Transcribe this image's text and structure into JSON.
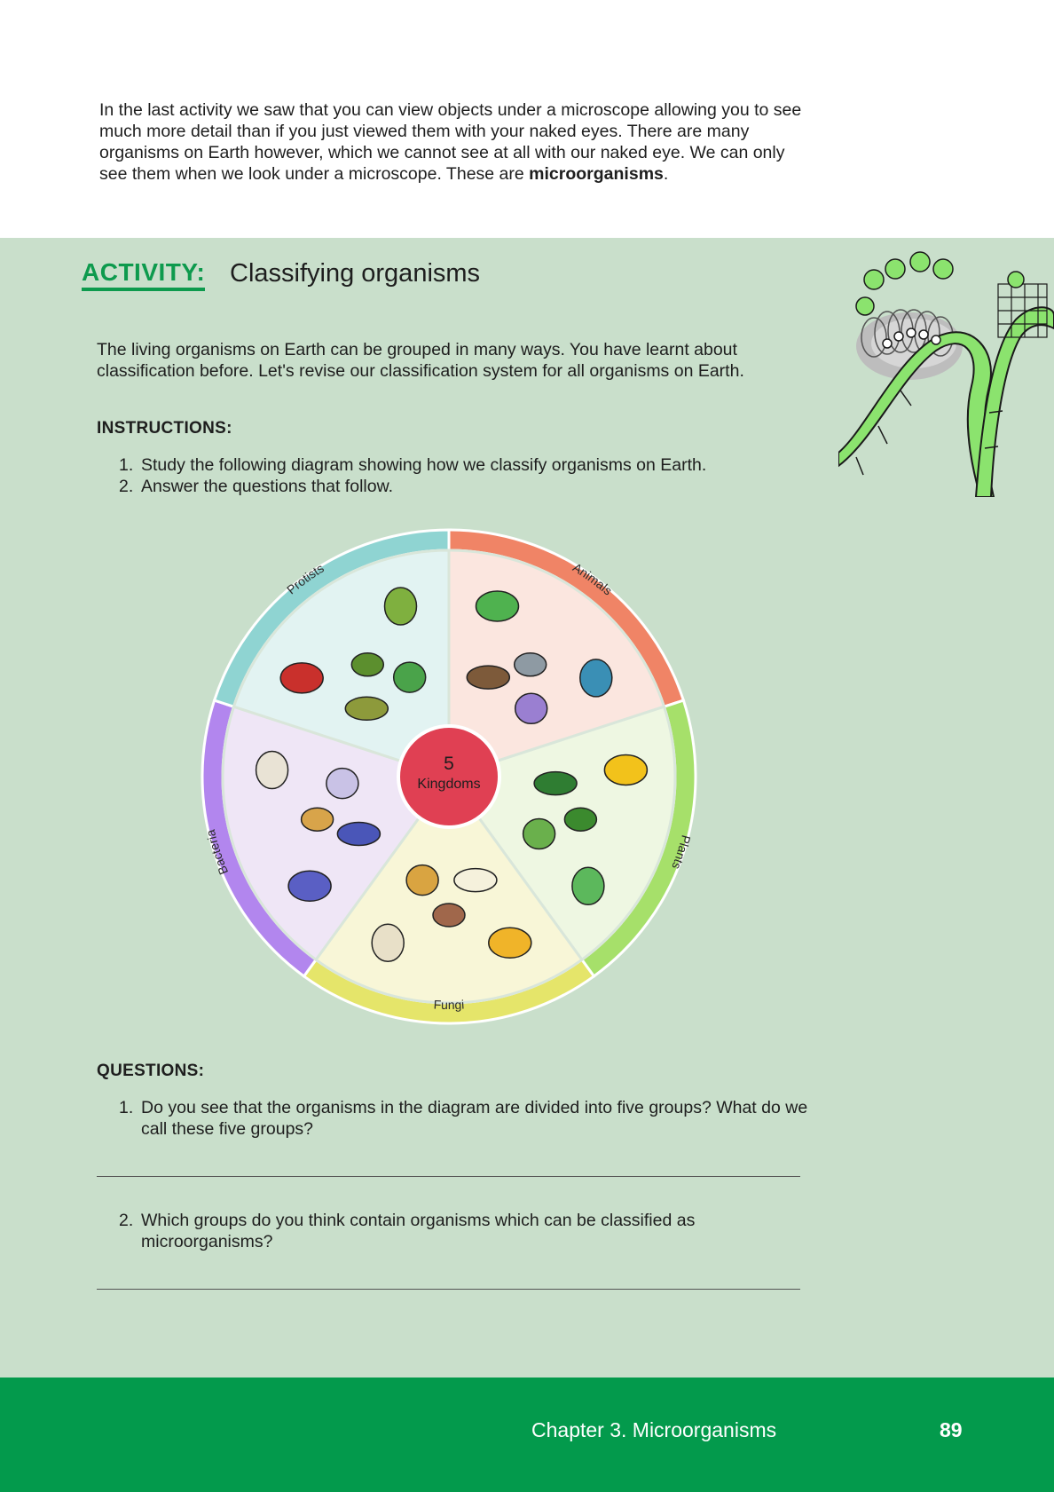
{
  "intro": {
    "text": "In the last activity we saw that you can view objects under a microscope allowing you to see much more detail than if you just viewed them with your naked eyes. There are many organisms on Earth however, which we cannot see at all with our naked eye. We can only see them when we look under a microscope. These are ",
    "bold_term": "microorganisms",
    "end": "."
  },
  "activity": {
    "label": "ACTIVITY:",
    "title": "Classifying organisms",
    "intro": "The living organisms on Earth can be grouped in many ways. You have learnt about classification before. Let's revise our classification system for all organisms on Earth.",
    "instructions_heading": "INSTRUCTIONS:",
    "instructions": [
      {
        "num": "1.",
        "text": "Study the following diagram showing how we classify organisms on Earth."
      },
      {
        "num": "2.",
        "text": "Answer the questions that follow."
      }
    ],
    "questions_heading": "QUESTIONS:",
    "questions": [
      {
        "num": "1.",
        "text": "Do you see that the organisms in the diagram are divided into five groups? What do we call these five groups?"
      },
      {
        "num": "2.",
        "text": "Which groups do you think contain organisms which can be classified as microorganisms?"
      }
    ]
  },
  "diagram": {
    "center_number": "5",
    "center_label": "Kingdoms",
    "kingdoms": [
      {
        "name": "Animals",
        "color": "#f08466",
        "fill": "#fbe6df"
      },
      {
        "name": "Plants",
        "color": "#a6e06a",
        "fill": "#eef7e2"
      },
      {
        "name": "Fungi",
        "color": "#e5e56a",
        "fill": "#f8f6d7"
      },
      {
        "name": "Bacteria",
        "color": "#b286ee",
        "fill": "#efe6f6"
      },
      {
        "name": "Protists",
        "color": "#8fd4d2",
        "fill": "#e2f3f2"
      }
    ],
    "center_color": "#e04053"
  },
  "footer": {
    "chapter": "Chapter 3.   Microorganisms",
    "page": "89"
  },
  "colors": {
    "activity_green": "#0d9a4d",
    "panel_bg": "#c9dfcb",
    "footer_bg": "#039a4c"
  }
}
